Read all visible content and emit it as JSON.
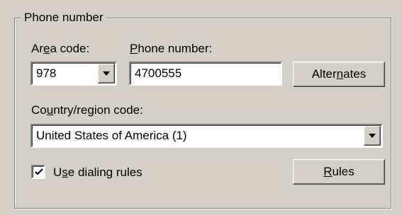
{
  "group": {
    "title": "Phone number"
  },
  "area_code": {
    "label_pre": "Ar",
    "label_u": "e",
    "label_post": "a code:",
    "value": "978",
    "dropdown_icon": "chevron-down-icon"
  },
  "phone_number": {
    "label_u": "P",
    "label_post": "hone number:",
    "value": "4700555"
  },
  "alternates_button": {
    "label_pre": "Alter",
    "label_u": "n",
    "label_post": "ates"
  },
  "country": {
    "label_pre": "Co",
    "label_u": "u",
    "label_post": "ntry/region code:",
    "value": "United States of America (1)",
    "dropdown_icon": "chevron-down-icon"
  },
  "dialing_rules": {
    "checked": true,
    "label_pre": "U",
    "label_u": "s",
    "label_post": "e dialing rules"
  },
  "rules_button": {
    "label_u": "R",
    "label_post": "ules"
  },
  "colors": {
    "panel_bg": "#d4d0c8",
    "field_bg": "#ffffff",
    "text": "#000000"
  }
}
